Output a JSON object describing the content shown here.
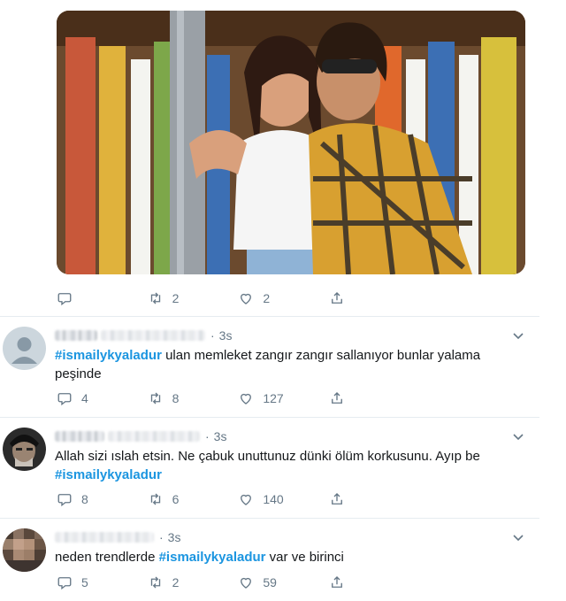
{
  "top_tweet": {
    "media_alt": "music video still",
    "actions": {
      "replies": "",
      "retweets": "2",
      "likes": "2"
    }
  },
  "replies": [
    {
      "time": "3s",
      "avatar": "default-avatar-icon",
      "parts": [
        {
          "type": "hashtag",
          "text": "#ismailykyaladur"
        },
        {
          "type": "text",
          "text": " ulan memleket zangır zangır sallanıyor bunlar yalama peşinde"
        }
      ],
      "actions": {
        "replies": "4",
        "retweets": "8",
        "likes": "127"
      }
    },
    {
      "time": "3s",
      "avatar": "photo-avatar",
      "parts": [
        {
          "type": "text",
          "text": "Allah sizi ıslah etsin. Ne çabuk unuttunuz dünki ölüm korkusunu. Ayıp be "
        },
        {
          "type": "hashtag",
          "text": "#ismailykyaladur"
        }
      ],
      "actions": {
        "replies": "8",
        "retweets": "6",
        "likes": "140"
      }
    },
    {
      "time": "3s",
      "avatar": "photo-avatar",
      "parts": [
        {
          "type": "text",
          "text": "neden trendlerde "
        },
        {
          "type": "hashtag",
          "text": "#ismailykyaladur"
        },
        {
          "type": "text",
          "text": " var ve birinci"
        }
      ],
      "actions": {
        "replies": "5",
        "retweets": "2",
        "likes": "59"
      }
    }
  ],
  "colors": {
    "accent": "#1b95e0",
    "muted": "#657786",
    "divider": "#e6ecf0"
  }
}
